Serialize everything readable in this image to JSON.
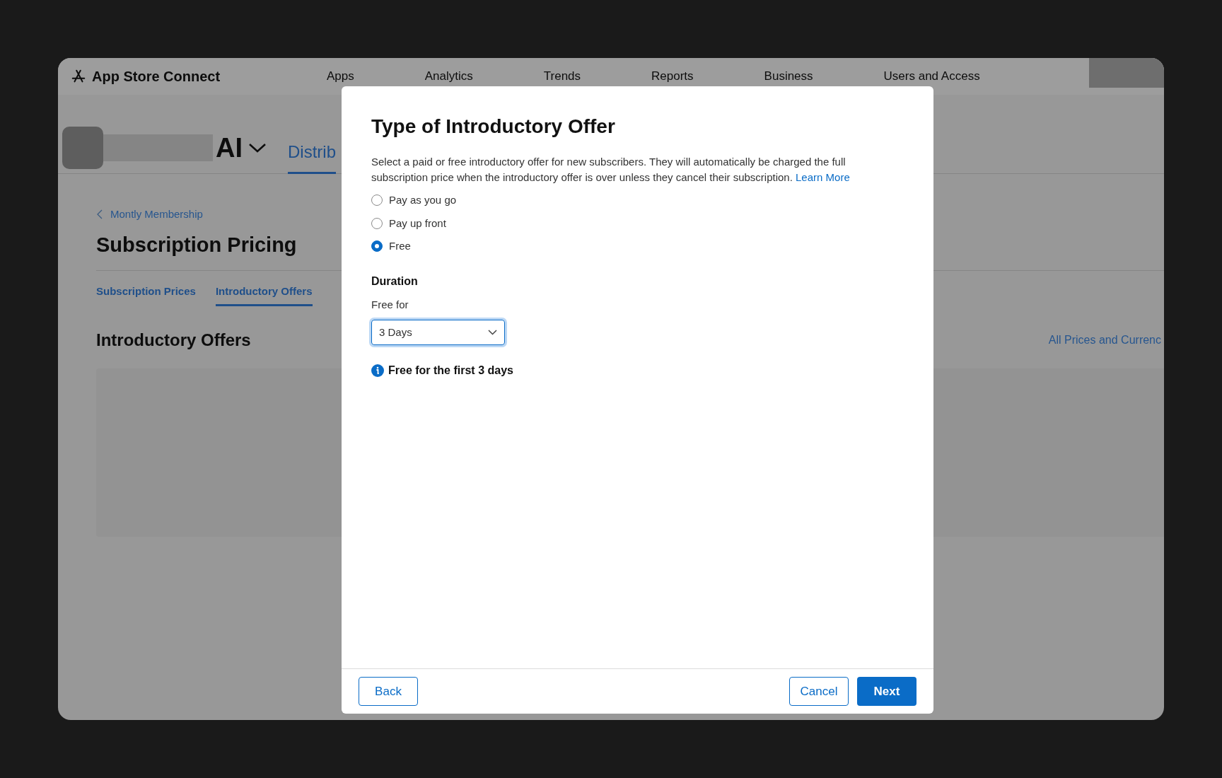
{
  "header": {
    "logo_text": "App Store Connect",
    "nav": [
      "Apps",
      "Analytics",
      "Trends",
      "Reports",
      "Business",
      "Users and Access"
    ]
  },
  "app_bar": {
    "app_name": "AI",
    "tab": "Distrib"
  },
  "page": {
    "breadcrumb": "Montly Membership",
    "title": "Subscription Pricing",
    "tabs": [
      {
        "label": "Subscription Prices",
        "selected": false
      },
      {
        "label": "Introductory Offers",
        "selected": true
      }
    ],
    "section_title": "Introductory Offers",
    "section_link": "All Prices and Currenc"
  },
  "dialog": {
    "title": "Type of Introductory Offer",
    "description": "Select a paid or free introductory offer for new subscribers. They will automatically be charged the full subscription price when the introductory offer is over unless they cancel their subscription.",
    "learn_more": "Learn More",
    "options": [
      {
        "label": "Pay as you go",
        "selected": false
      },
      {
        "label": "Pay up front",
        "selected": false
      },
      {
        "label": "Free",
        "selected": true
      }
    ],
    "duration": {
      "heading": "Duration",
      "label": "Free for",
      "value": "3 Days"
    },
    "info": "Free for the first 3 days",
    "buttons": {
      "back": "Back",
      "cancel": "Cancel",
      "next": "Next"
    }
  }
}
